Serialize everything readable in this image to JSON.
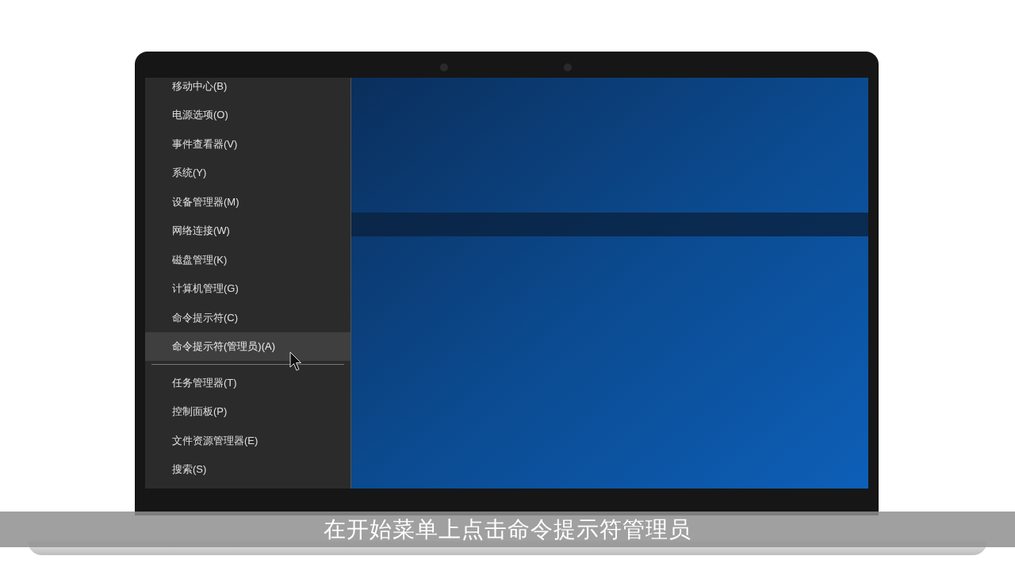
{
  "menu": {
    "items": [
      {
        "label": "移动中心(B)",
        "selected": false
      },
      {
        "label": "电源选项(O)",
        "selected": false
      },
      {
        "label": "事件查看器(V)",
        "selected": false
      },
      {
        "label": "系统(Y)",
        "selected": false
      },
      {
        "label": "设备管理器(M)",
        "selected": false
      },
      {
        "label": "网络连接(W)",
        "selected": false
      },
      {
        "label": "磁盘管理(K)",
        "selected": false
      },
      {
        "label": "计算机管理(G)",
        "selected": false
      },
      {
        "label": "命令提示符(C)",
        "selected": false
      },
      {
        "label": "命令提示符(管理员)(A)",
        "selected": true,
        "separator_after": true
      },
      {
        "label": "任务管理器(T)",
        "selected": false
      },
      {
        "label": "控制面板(P)",
        "selected": false
      },
      {
        "label": "文件资源管理器(E)",
        "selected": false
      },
      {
        "label": "搜索(S)",
        "selected": false
      }
    ]
  },
  "subtitle": "在开始菜单上点击命令提示符管理员"
}
